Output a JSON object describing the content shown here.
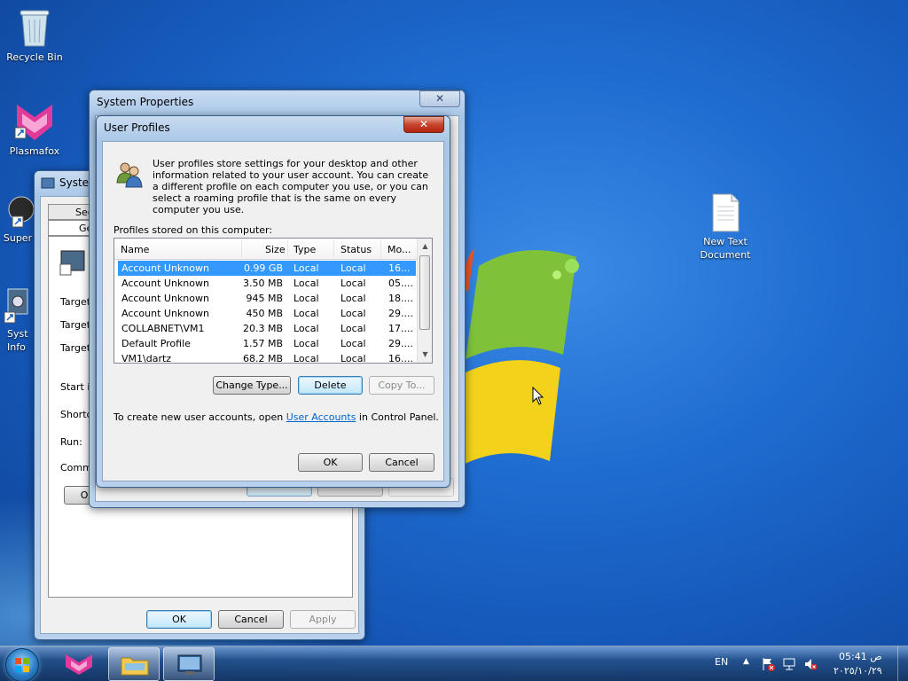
{
  "desktop": {
    "icons": [
      {
        "label": "Recycle Bin"
      },
      {
        "label": "Plasmafox"
      },
      {
        "label": "Super"
      },
      {
        "label": "Syst Info"
      },
      {
        "label": "New Text Document"
      }
    ]
  },
  "bg_window": {
    "title": "System",
    "tabs": [
      "Sec",
      "Ge"
    ],
    "labels": [
      "Target",
      "Target",
      "Target",
      "Start in",
      "Shortcu",
      "Run:",
      "Comme"
    ],
    "open_button": "Ope",
    "ok": "OK",
    "cancel": "Cancel",
    "apply": "Apply"
  },
  "system_properties": {
    "title": "System Properties",
    "close": "✕"
  },
  "user_profiles": {
    "title": "User Profiles",
    "close": "✕",
    "description": "User profiles store settings for your desktop and other information related to your user account. You can create a different profile on each computer you use, or you can select a roaming profile that is the same on every computer you use.",
    "profiles_label": "Profiles stored on this computer:",
    "columns": [
      "Name",
      "Size",
      "Type",
      "Status",
      "Mo..."
    ],
    "rows": [
      {
        "name": "Account Unknown",
        "size": "0.99 GB",
        "type": "Local",
        "status": "Local",
        "mod": "16..."
      },
      {
        "name": "Account Unknown",
        "size": "3.50 MB",
        "type": "Local",
        "status": "Local",
        "mod": "05...."
      },
      {
        "name": "Account Unknown",
        "size": "945 MB",
        "type": "Local",
        "status": "Local",
        "mod": "18...."
      },
      {
        "name": "Account Unknown",
        "size": "450 MB",
        "type": "Local",
        "status": "Local",
        "mod": "29...."
      },
      {
        "name": "COLLABNET\\VM1",
        "size": "20.3 MB",
        "type": "Local",
        "status": "Local",
        "mod": "17...."
      },
      {
        "name": "Default Profile",
        "size": "1.57 MB",
        "type": "Local",
        "status": "Local",
        "mod": "29...."
      },
      {
        "name": "VM1\\dartz",
        "size": "68.2 MB",
        "type": "Local",
        "status": "Local",
        "mod": "16...."
      }
    ],
    "buttons": {
      "change_type": "Change Type...",
      "delete": "Delete",
      "copy_to": "Copy To..."
    },
    "footer_prefix": "To create new user accounts, open ",
    "footer_link": "User Accounts",
    "footer_suffix": " in Control Panel.",
    "ok": "OK",
    "cancel": "Cancel"
  },
  "taskbar": {
    "language": "EN",
    "time": "05:41 ص",
    "date": "٢٠٢٥/١٠/٢٩"
  }
}
